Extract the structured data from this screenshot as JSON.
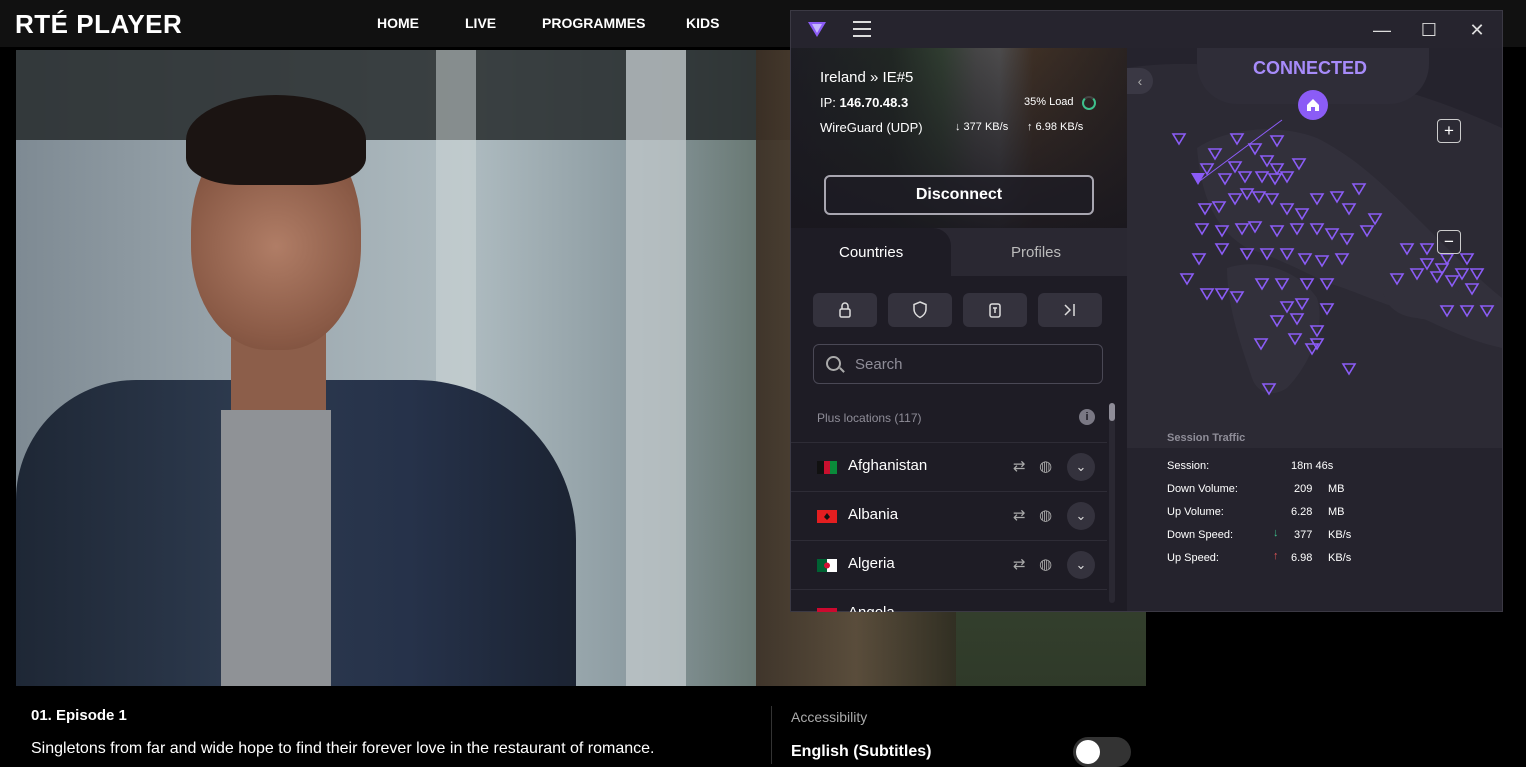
{
  "rte": {
    "logo": "RTÉ PLAYER",
    "nav": [
      "HOME",
      "LIVE",
      "PROGRAMMES",
      "KIDS"
    ]
  },
  "episode": {
    "title": "01. Episode 1",
    "description": "Singletons from far and wide hope to find their forever love in the restaurant of romance.",
    "accessibility_label": "Accessibility",
    "subtitle_language": "English (Subtitles)",
    "subtitles_enabled": false
  },
  "vpn": {
    "window_controls": {
      "minimize": "—",
      "maximize": "☐",
      "close": "✕"
    },
    "location": "Ireland » IE#5",
    "ip_label": "IP:",
    "ip": "146.70.48.3",
    "load": "35% Load",
    "protocol": "WireGuard (UDP)",
    "download": "↓ 377 KB/s",
    "upload": "↑ 6.98 KB/s",
    "disconnect_label": "Disconnect",
    "tabs": {
      "countries": "Countries",
      "profiles": "Profiles"
    },
    "filters": [
      "lock-icon",
      "shield-icon",
      "tor-icon",
      "p2p-icon"
    ],
    "search_placeholder": "Search",
    "plus_locations": "Plus locations (117)",
    "countries": [
      {
        "name": "Afghanistan"
      },
      {
        "name": "Albania"
      },
      {
        "name": "Algeria"
      },
      {
        "name": "Angola"
      }
    ],
    "status": "CONNECTED",
    "session_traffic": {
      "title": "Session Traffic",
      "rows": [
        {
          "label": "Session:",
          "value": "18m 46s",
          "unit": "",
          "arrow": ""
        },
        {
          "label": "Down Volume:",
          "value": "209",
          "unit": "MB",
          "arrow": ""
        },
        {
          "label": "Up Volume:",
          "value": "6.28",
          "unit": "MB",
          "arrow": ""
        },
        {
          "label": "Down Speed:",
          "value": "377",
          "unit": "KB/s",
          "arrow": "↓"
        },
        {
          "label": "Up Speed:",
          "value": "6.98",
          "unit": "KB/s",
          "arrow": "↑"
        }
      ]
    },
    "colors": {
      "accent": "#8b5cf6",
      "connected": "#a78bfa",
      "down_arrow": "#3ec08c",
      "up_arrow": "#e05555"
    }
  }
}
